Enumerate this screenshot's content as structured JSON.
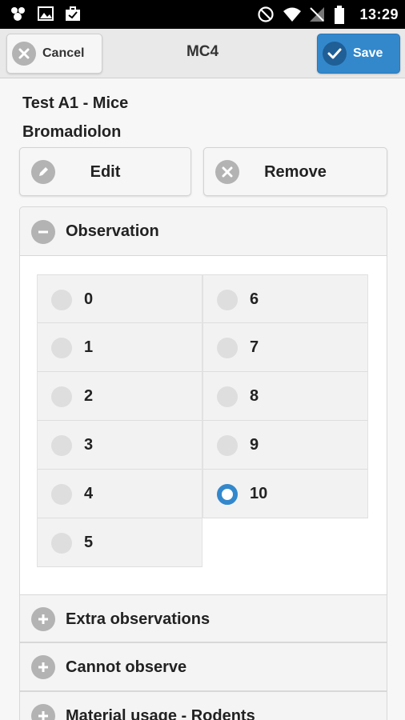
{
  "status_bar": {
    "time": "13:29",
    "left_icons": [
      "app-icon",
      "image-icon",
      "briefcase-check-icon"
    ],
    "right_icons": [
      "do-not-disturb-icon",
      "wifi-icon",
      "no-signal-icon",
      "battery-icon"
    ]
  },
  "header": {
    "title": "MC4",
    "cancel_label": "Cancel",
    "save_label": "Save",
    "accent": "#3388cc"
  },
  "trap": {
    "name": "Test A1 - Mice",
    "bait": "Bromadiolon"
  },
  "actions": {
    "edit_label": "Edit",
    "remove_label": "Remove"
  },
  "observation": {
    "title": "Observation",
    "options_left": [
      "0",
      "1",
      "2",
      "3",
      "4",
      "5"
    ],
    "options_right": [
      "6",
      "7",
      "8",
      "9",
      "10"
    ],
    "selected": "10"
  },
  "sections": {
    "extra": "Extra observations",
    "cannot": "Cannot observe",
    "material": "Material usage - Rodents"
  }
}
